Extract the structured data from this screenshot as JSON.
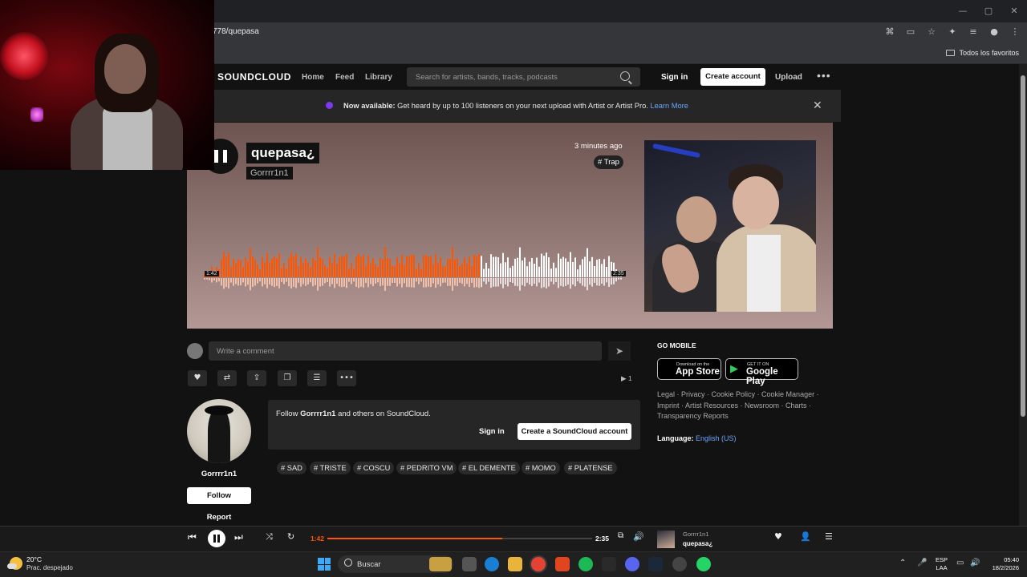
{
  "browser": {
    "url": "778/quepasa",
    "window_controls": [
      "—",
      "▢",
      "✕"
    ],
    "favorites_label": "Todos los favoritos"
  },
  "soundcloud": {
    "logo": "SOUNDCLOUD",
    "nav": [
      "Home",
      "Feed",
      "Library"
    ],
    "search_placeholder": "Search for artists, bands, tracks, podcasts",
    "sign_in": "Sign in",
    "create_account": "Create account",
    "upload": "Upload",
    "more": "•••",
    "accent_color": "#ff5500"
  },
  "banner": {
    "bold": "Now available:",
    "text": " Get heard by up to 100 listeners on your next upload with Artist or Artist Pro. ",
    "link": "Learn More",
    "close": "✕"
  },
  "track": {
    "title": "quepasa¿",
    "artist": "Gorrrr1n1",
    "posted": "3 minutes ago",
    "tag": "# Trap",
    "current_time": "1:42",
    "duration": "2:35",
    "progress": 0.66
  },
  "comment": {
    "placeholder": "Write a comment",
    "send_icon": "send-icon"
  },
  "actions": {
    "buttons": [
      "♥",
      "⇄",
      "⇪",
      "❐",
      "☰",
      "•••"
    ],
    "plays": "▶ 1"
  },
  "artist_panel": {
    "name": "Gorrrr1n1",
    "follow": "Follow",
    "report": "Report"
  },
  "follow_prompt": {
    "pre": "Follow ",
    "name": "Gorrrr1n1",
    "post": " and others on SoundCloud.",
    "sign_in": "Sign in",
    "create": "Create a SoundCloud account"
  },
  "tags": [
    "# SAD",
    "# TRISTE",
    "# COSCU",
    "# PEDRITO VM",
    "# EL DEMENTE",
    "# MOMO",
    "# PLATENSE"
  ],
  "sidebar": {
    "go_mobile": "GO MOBILE",
    "app_store_small": "Download on the",
    "app_store_big": "App Store",
    "play_small": "GET IT ON",
    "play_big": "Google Play",
    "legal": "Legal · Privacy · Cookie Policy · Cookie Manager · Imprint · Artist Resources · Newsroom · Charts · Transparency Reports",
    "language_label": "Language: ",
    "language_value": "English (US)"
  },
  "player": {
    "current": "1:42",
    "duration": "2:35",
    "artist": "Gorrrr1n1",
    "title": "quepasa¿"
  },
  "taskbar": {
    "temp": "20°C",
    "weather": "Prac. despejado",
    "search": "Buscar",
    "lang_line1": "ESP",
    "lang_line2": "LAA",
    "time": "05:40",
    "date": "18/2/2026"
  }
}
